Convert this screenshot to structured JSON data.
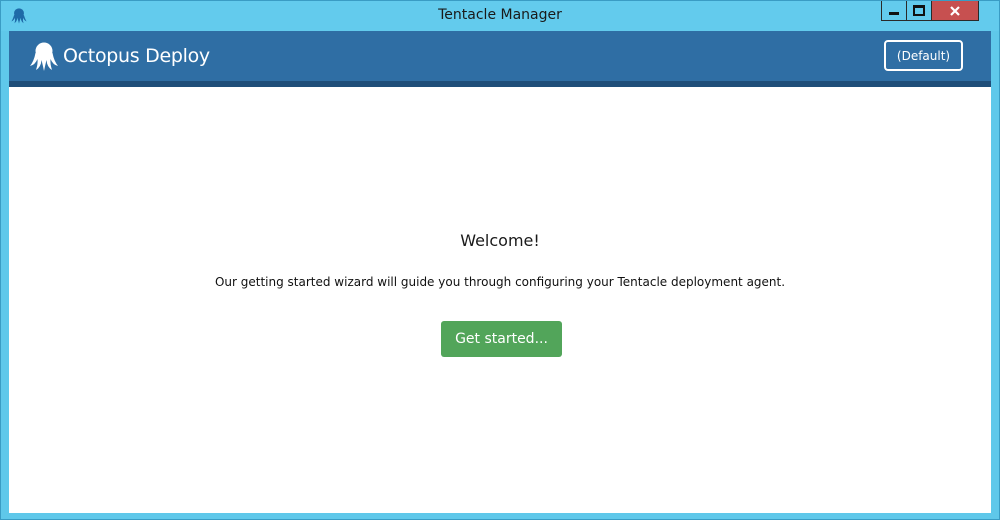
{
  "window": {
    "title": "Tentacle Manager",
    "app_icon": "octopus-icon",
    "controls": {
      "minimize_icon": "minimize-icon",
      "maximize_icon": "maximize-icon",
      "close_icon": "close-icon"
    }
  },
  "header": {
    "brand_name": "Octopus Deploy",
    "logo_icon": "octopus-logo-icon",
    "instance_label": "(Default)",
    "bg_color": "#2f6ea4"
  },
  "main": {
    "heading": "Welcome!",
    "description": "Our getting started wizard will guide you through configuring your Tentacle deployment agent.",
    "cta_label": "Get started...",
    "cta_color": "#52a55a"
  }
}
